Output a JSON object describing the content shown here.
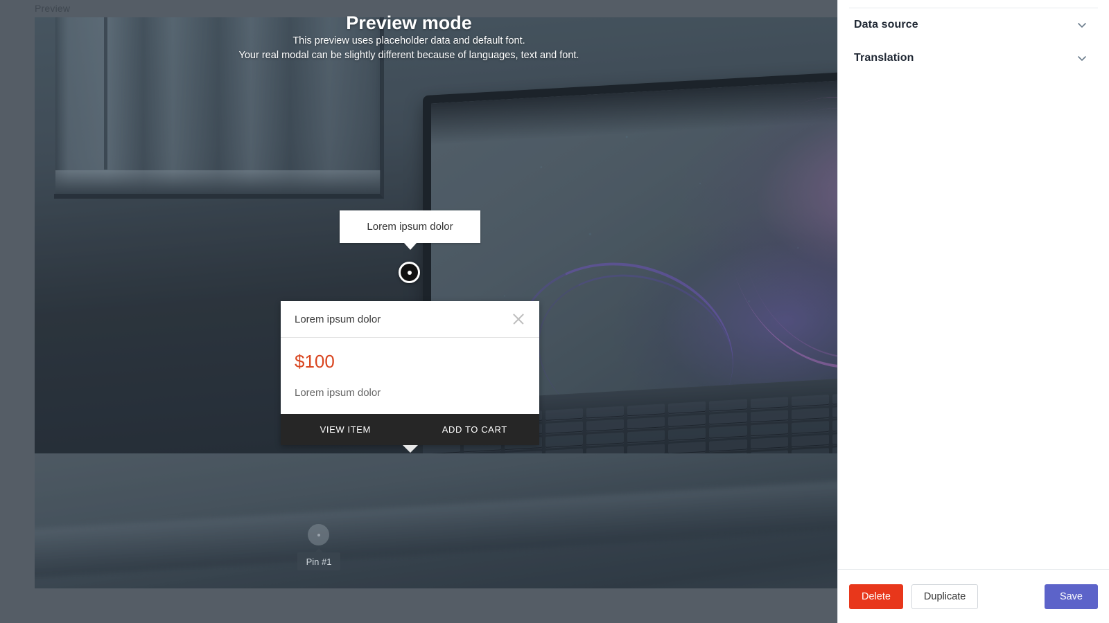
{
  "preview": {
    "label": "Preview",
    "title": "Preview mode",
    "subtitle_line1": "This preview uses placeholder data and default font.",
    "subtitle_line2": "Your real modal can be slightly different because of languages, text and font."
  },
  "tooltip": {
    "text": "Lorem ipsum dolor"
  },
  "pin_active": {
    "icon": "pin-dot-icon"
  },
  "card": {
    "title": "Lorem ipsum dolor",
    "close_icon": "close-icon",
    "price": "$100",
    "description": "Lorem ipsum dolor",
    "view_item_label": "VIEW ITEM",
    "add_to_cart_label": "ADD TO CART"
  },
  "pin_idle": {
    "badge": "Pin #1"
  },
  "panel": {
    "sections": [
      {
        "label": "Data source",
        "icon": "chevron-down-icon"
      },
      {
        "label": "Translation",
        "icon": "chevron-down-icon"
      }
    ],
    "footer": {
      "delete_label": "Delete",
      "duplicate_label": "Duplicate",
      "save_label": "Save"
    }
  },
  "colors": {
    "delete": "#e8371b",
    "save": "#5c63c9",
    "price": "#d9451f",
    "card_footer": "#262626",
    "backdrop": "#555d66"
  }
}
